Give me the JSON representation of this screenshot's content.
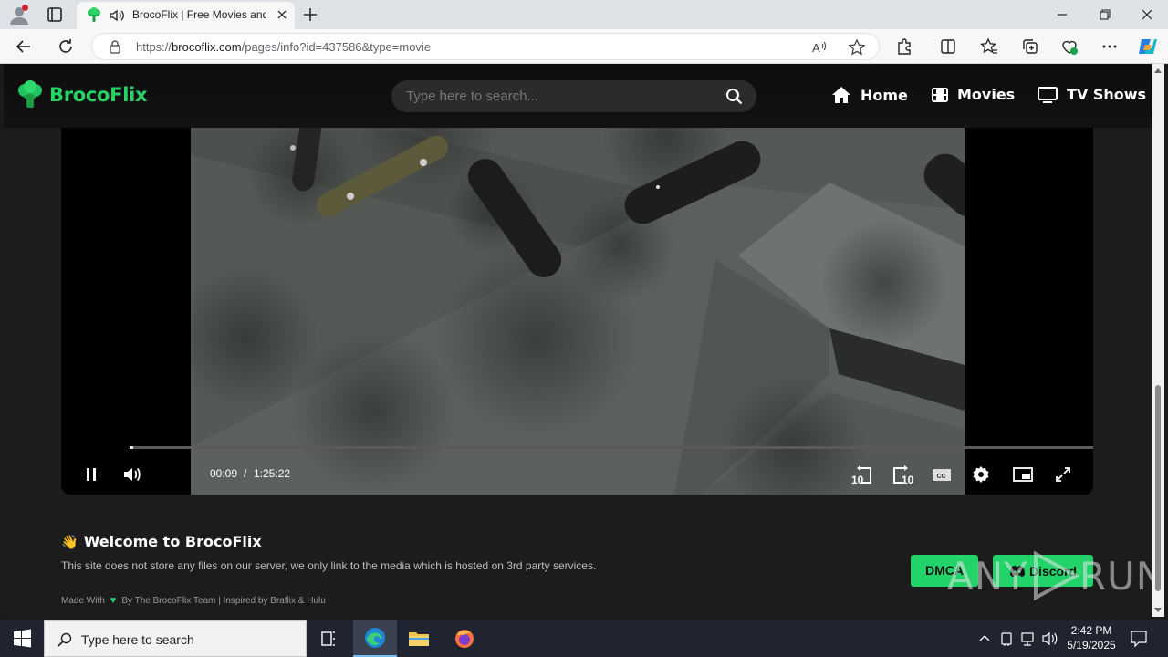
{
  "browser": {
    "tab_title": "BrocoFlix | Free Movies and TV Shows",
    "url_prefix": "https://",
    "url_domain": "brocoflix.com",
    "url_path": "/pages/info?id=437586&type=movie"
  },
  "site": {
    "brand": "BrocoFlix",
    "search_placeholder": "Type here to search...",
    "nav": {
      "home": "Home",
      "movies": "Movies",
      "tv_shows": "TV Shows"
    }
  },
  "player": {
    "current_time": "00:09",
    "separator": "/",
    "duration": "1:25:22",
    "progress_fraction": 0.0018,
    "rewind_seconds": "10",
    "forward_seconds": "10",
    "cc_label": "CC"
  },
  "footer": {
    "welcome_emoji": "👋",
    "welcome_title": "Welcome to BrocoFlix",
    "disclaimer": "This site does not store any files on our server, we only link to the media which is hosted on 3rd party services.",
    "made_with": "Made With",
    "credits": "By The BrocoFlix Team | Inspired by Braflix & Hulu",
    "dmca": "DMCA",
    "discord": "Discord"
  },
  "watermark": {
    "left": "ANY",
    "right": "RUN"
  },
  "taskbar": {
    "search_placeholder": "Type here to search",
    "time": "2:42 PM",
    "date": "5/19/2025"
  },
  "colors": {
    "accent": "#25d366",
    "page_bg": "#1c1c1c",
    "taskbar": "#1f2430"
  },
  "icons": [
    "profile-icon",
    "tabs-icon",
    "broccoli-favicon",
    "speaker-icon",
    "close-icon",
    "plus-icon",
    "back-icon",
    "reload-icon",
    "lock-icon",
    "read-aloud-icon",
    "star-icon",
    "extensions-icon",
    "split-screen-icon",
    "favorites-icon",
    "collections-icon",
    "browser-essentials-icon",
    "more-icon",
    "copilot-icon",
    "search-icon",
    "home-icon",
    "film-icon",
    "tv-icon",
    "pause-icon",
    "volume-icon",
    "rewind-10-icon",
    "forward-10-icon",
    "cc-icon",
    "settings-icon",
    "pip-icon",
    "fullscreen-icon",
    "heart-icon",
    "discord-icon",
    "windows-icon",
    "task-view-icon",
    "edge-icon",
    "file-explorer-icon",
    "firefox-icon"
  ]
}
